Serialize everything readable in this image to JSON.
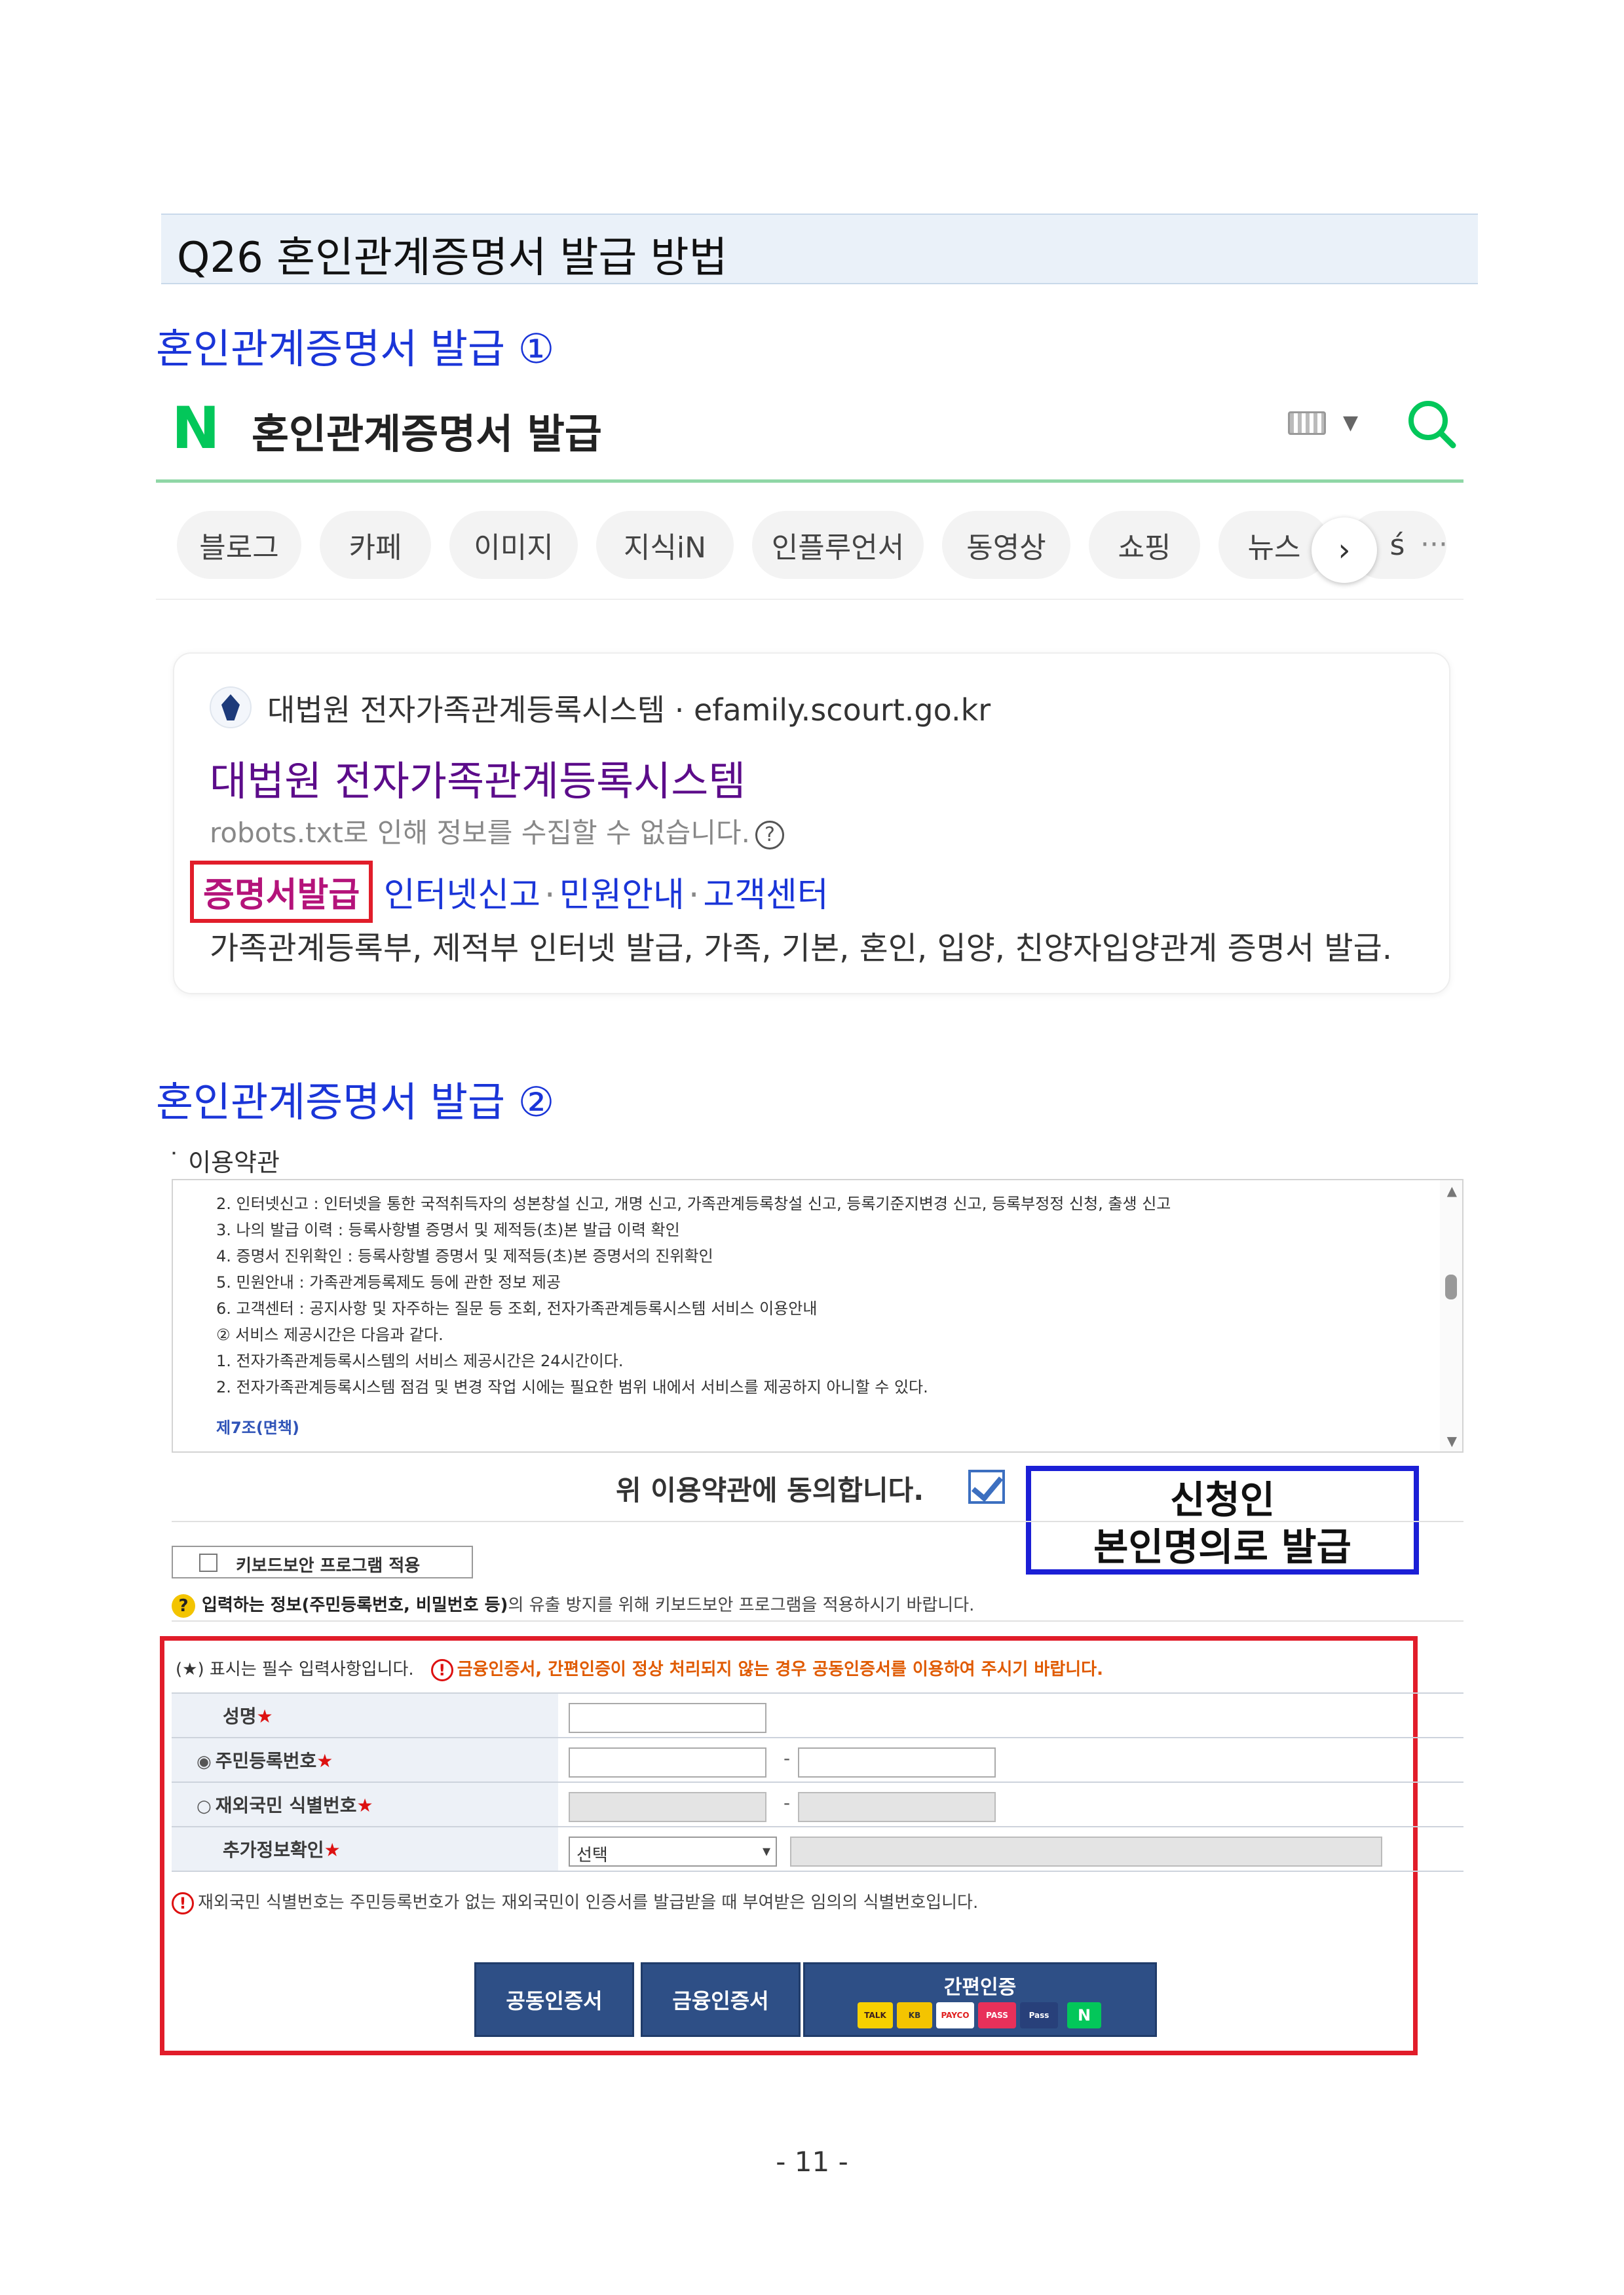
{
  "page_title": "Q26 혼인관계증명서 발급 방법",
  "section1_title": "혼인관계증명서 발급 ①",
  "section2_title": "혼인관계증명서 발급 ②",
  "search": {
    "logo": "N",
    "query": "혼인관계증명서 발급",
    "tabs": [
      "블로그",
      "카페",
      "이미지",
      "지식iN",
      "인플루언서",
      "동영상",
      "쇼핑",
      "뉴스",
      "\u001f"
    ],
    "tab_next": "›",
    "tab_more": "···",
    "result": {
      "site_name": "대법원 전자가족관계등록시스템 · efamily.scourt.go.kr",
      "title": "대법원 전자가족관계등록시스템",
      "robots_note": "robots.txt로 인해 정보를 수집할 수 없습니다.",
      "robots_help": "?",
      "links": [
        "증명서발급",
        "인터넷신고",
        "민원안내",
        "고객센터"
      ],
      "link_sep": "·",
      "description": "가족관계등록부, 제적부 인터넷 발급, 가족, 기본, 혼인, 입양, 친양자입양관계 증명서 발급."
    }
  },
  "form": {
    "terms_heading": "˙ 이용약관",
    "terms_lines": [
      "2. 인터넷신고 : 인터넷을 통한 국적취득자의 성본창설 신고, 개명 신고, 가족관계등록창설 신고, 등록기준지변경 신고, 등록부정정 신청, 출생 신고",
      "3. 나의 발급 이력 : 등록사항별 증명서 및 제적등(초)본 발급 이력 확인",
      "4. 증명서 진위확인 : 등록사항별 증명서 및 제적등(초)본 증명서의 진위확인",
      "5. 민원안내 : 가족관계등록제도 등에 관한 정보 제공",
      "6. 고객센터 : 공지사항 및 자주하는 질문 등 조회, 전자가족관계등록시스템 서비스 이용안내",
      "② 서비스 제공시간은 다음과 같다.",
      "1. 전자가족관계등록시스템의 서비스 제공시간은 24시간이다.",
      "2. 전자가족관계등록시스템 점검 및 변경 작업 시에는 필요한 범위 내에서 서비스를 제공하지 아니할 수 있다."
    ],
    "terms_article": "제7조(면책)",
    "agree_text": "위 이용약관에 동의합니다.",
    "callout_line1": "신청인",
    "callout_line2": "본인명의로 발급",
    "keyboard_label": "키보드보안 프로그램 적용",
    "keyboard_note_bold": "입력하는 정보(주민등록번호, 비밀번호 등)",
    "keyboard_note_rest": "의 유출 방지를 위해 키보드보안 프로그램을 적용하시기 바랍니다.",
    "help_mark": "?",
    "required_note": "(★) 표시는 필수 입력사항입니다.",
    "warn_mark": "!",
    "warning": "금융인증서, 간편인증이 정상 처리되지 않는 경우 공동인증서를 이용하여 주시기 바랍니다.",
    "radio_on": "◉",
    "radio_off": "○",
    "star": "★",
    "dash": "-",
    "fields": {
      "name": "성명",
      "rrn": "주민등록번호",
      "foreign_id": "재외국민 식별번호",
      "extra": "추가정보확인"
    },
    "extra_select": "선택",
    "foreign_note": "재외국민 식별번호는 주민등록번호가 없는 재외국민이 인증서를 발급받을 때 부여받은 임의의 식별번호입니다.",
    "buttons": {
      "joint_cert": "공동인증서",
      "financial_cert": "금융인증서",
      "simple_auth": "간편인증"
    },
    "simple_auth_providers": [
      "TALK",
      "KB",
      "PAYCO",
      "PASS",
      "Pass",
      "N"
    ]
  },
  "page_number": "- 11 -",
  "colors": {
    "section_title": "#1a35d8",
    "naver_green": "#03c75a",
    "highlight_red": "#e11d2a",
    "highlight_blue": "#1b1fd6",
    "button_navy": "#2e4f86"
  }
}
